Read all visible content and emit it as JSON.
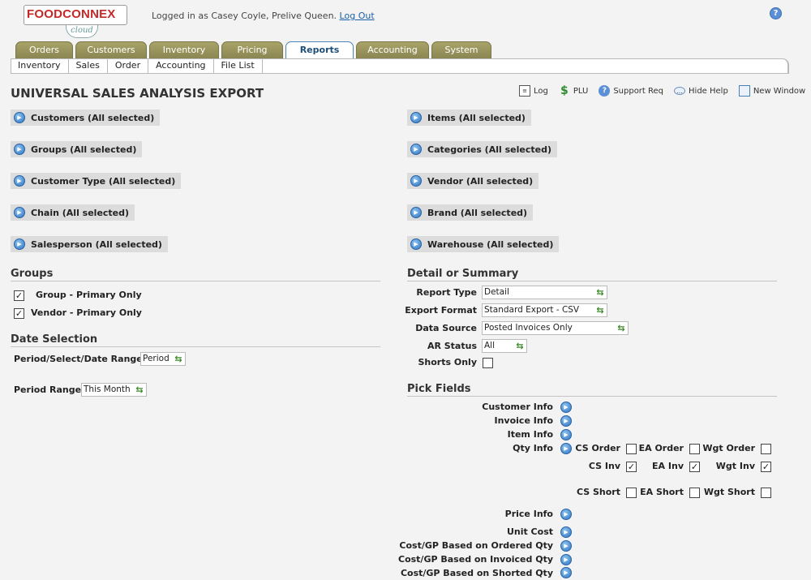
{
  "header": {
    "logo_main": "FOODCONNEX",
    "logo_sub": "cloud",
    "login_text": "Logged in as Casey Coyle, Prelive Queen.",
    "logout_label": "Log Out",
    "help_icon": "?"
  },
  "tabs": [
    "Orders",
    "Customers",
    "Inventory",
    "Pricing",
    "Reports",
    "Accounting",
    "System"
  ],
  "active_tab": "Reports",
  "subtabs": [
    "Inventory",
    "Sales",
    "Order",
    "Accounting",
    "File List"
  ],
  "page_title": "UNIVERSAL SALES ANALYSIS EXPORT",
  "tools": {
    "log": "Log",
    "plu": "PLU",
    "support": "Support Req",
    "hide_help": "Hide Help",
    "new_window": "New Window"
  },
  "filters_left": [
    "Customers (All selected)",
    "Groups (All selected)",
    "Customer Type (All selected)",
    "Chain (All selected)",
    "Salesperson (All selected)"
  ],
  "filters_right": [
    "Items (All selected)",
    "Categories (All selected)",
    "Vendor (All selected)",
    "Brand (All selected)",
    "Warehouse (All selected)"
  ],
  "groups": {
    "heading": "Groups",
    "group_primary": {
      "label": "Group - Primary Only",
      "checked": true
    },
    "vendor_primary": {
      "label": "Vendor - Primary Only",
      "checked": true
    }
  },
  "date_selection": {
    "heading": "Date Selection",
    "period_label": "Period/Select/Date Range",
    "period_value": "Period",
    "range_label": "Period Range",
    "range_value": "This Month"
  },
  "detail_summary": {
    "heading": "Detail or Summary",
    "report_type_label": "Report Type",
    "report_type_value": "Detail",
    "export_format_label": "Export Format",
    "export_format_value": "Standard Export - CSV",
    "data_source_label": "Data Source",
    "data_source_value": "Posted Invoices Only",
    "ar_status_label": "AR Status",
    "ar_status_value": "All",
    "shorts_only_label": "Shorts Only",
    "shorts_only_checked": false
  },
  "pick_fields": {
    "heading": "Pick Fields",
    "customer_info": "Customer Info",
    "invoice_info": "Invoice Info",
    "item_info": "Item Info",
    "qty_info": "Qty Info",
    "cs_order": "CS Order",
    "ea_order": "EA Order",
    "wgt_order": "Wgt Order",
    "cs_inv": "CS Inv",
    "ea_inv": "EA Inv",
    "wgt_inv": "Wgt Inv",
    "cs_short": "CS Short",
    "ea_short": "EA Short",
    "wgt_short": "Wgt Short",
    "price_info": "Price Info",
    "unit_cost": "Unit Cost",
    "cost_ordered": "Cost/GP Based on Ordered Qty",
    "cost_invoiced": "Cost/GP Based on Invoiced Qty",
    "cost_shorted": "Cost/GP Based on Shorted Qty",
    "checks": {
      "cs_order": false,
      "ea_order": false,
      "wgt_order": false,
      "cs_inv": true,
      "ea_inv": true,
      "wgt_inv": true,
      "cs_short": false,
      "ea_short": false,
      "wgt_short": false
    }
  },
  "icons": {
    "check": "✓",
    "blue_arrow": "▶",
    "green_arrow": "⇆"
  }
}
